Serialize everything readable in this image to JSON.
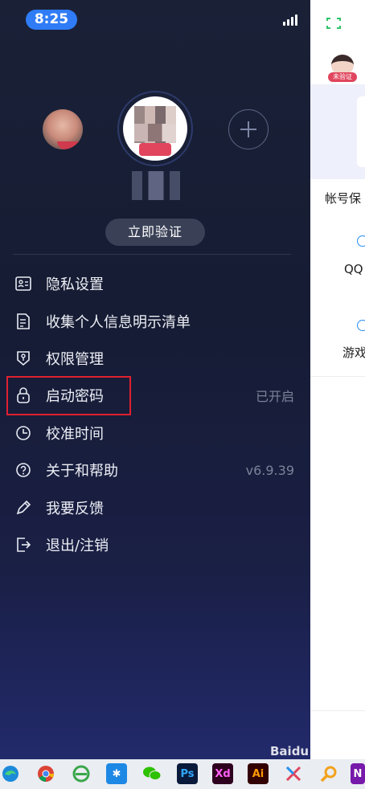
{
  "status_bar": {
    "time": "8:25"
  },
  "profile": {
    "verify_button": "立即验证"
  },
  "menu": [
    {
      "label": "隐私设置",
      "value": "",
      "icon": "id-card-icon"
    },
    {
      "label": "收集个人信息明示清单",
      "value": "",
      "icon": "document-list-icon"
    },
    {
      "label": "权限管理",
      "value": "",
      "icon": "shield-key-icon"
    },
    {
      "label": "启动密码",
      "value": "已开启",
      "icon": "lock-icon"
    },
    {
      "label": "校准时间",
      "value": "",
      "icon": "clock-icon"
    },
    {
      "label": "关于和帮助",
      "value": "v6.9.39",
      "icon": "help-circle-icon"
    },
    {
      "label": "我要反馈",
      "value": "",
      "icon": "pencil-icon"
    },
    {
      "label": "退出/注销",
      "value": "",
      "icon": "exit-icon"
    }
  ],
  "background_app": {
    "badge": "未验证",
    "items": [
      "帐号保",
      "QQ",
      "游戏"
    ]
  },
  "taskbar": {
    "apps": [
      "edge-icon",
      "chrome-icon",
      "ie-icon",
      "tencent-doc-icon",
      "wechat-icon",
      "photoshop-icon",
      "xd-icon",
      "illustrator-icon",
      "xmind-icon",
      "search-magnifier-icon",
      "onenote-icon"
    ],
    "labels": {
      "ps": "Ps",
      "xd": "Xd",
      "ai": "Ai",
      "on": "N"
    }
  },
  "watermark": "Baidu 经验",
  "colors": {
    "accent": "#2f7cf6",
    "highlight": "#e0202f"
  }
}
